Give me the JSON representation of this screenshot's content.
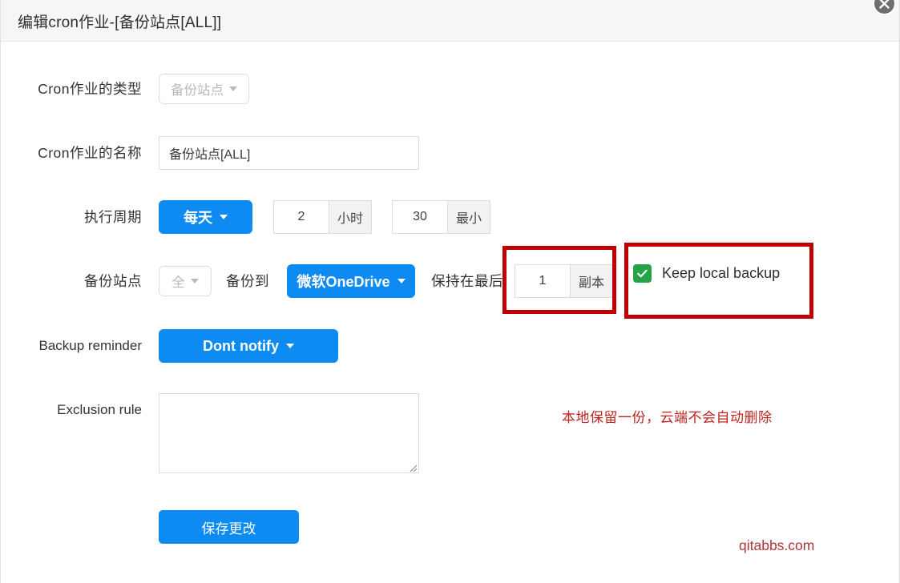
{
  "header": {
    "title": "编辑cron作业-[备份站点[ALL]]",
    "close_icon": "close-icon"
  },
  "form": {
    "cron_type": {
      "label": "Cron作业的类型",
      "value": "备份站点",
      "disabled": true
    },
    "cron_name": {
      "label": "Cron作业的名称",
      "value": "备份站点[ALL]",
      "placeholder": ""
    },
    "schedule": {
      "label": "执行周期",
      "period_value": "每天",
      "hour_value": "2",
      "hour_unit": "小时",
      "minute_value": "30",
      "minute_unit": "最小"
    },
    "backup_site": {
      "label": "备份站点",
      "site_value": "全",
      "backup_to_label": "备份到",
      "destination_value": "微软OneDrive",
      "keep_last_label": "保持在最后",
      "copies_value": "1",
      "copies_unit": "副本",
      "keep_local_label": "Keep local backup",
      "keep_local_checked": true
    },
    "backup_reminder": {
      "label": "Backup reminder",
      "value": "Dont notify"
    },
    "exclusion_rule": {
      "label": "Exclusion rule",
      "value": "",
      "placeholder": ""
    },
    "save_button": "保存更改"
  },
  "annotations": {
    "note_text": "本地保留一份，云端不会自动删除",
    "watermark": "qitabbs.com",
    "box_color": "#c00000"
  }
}
